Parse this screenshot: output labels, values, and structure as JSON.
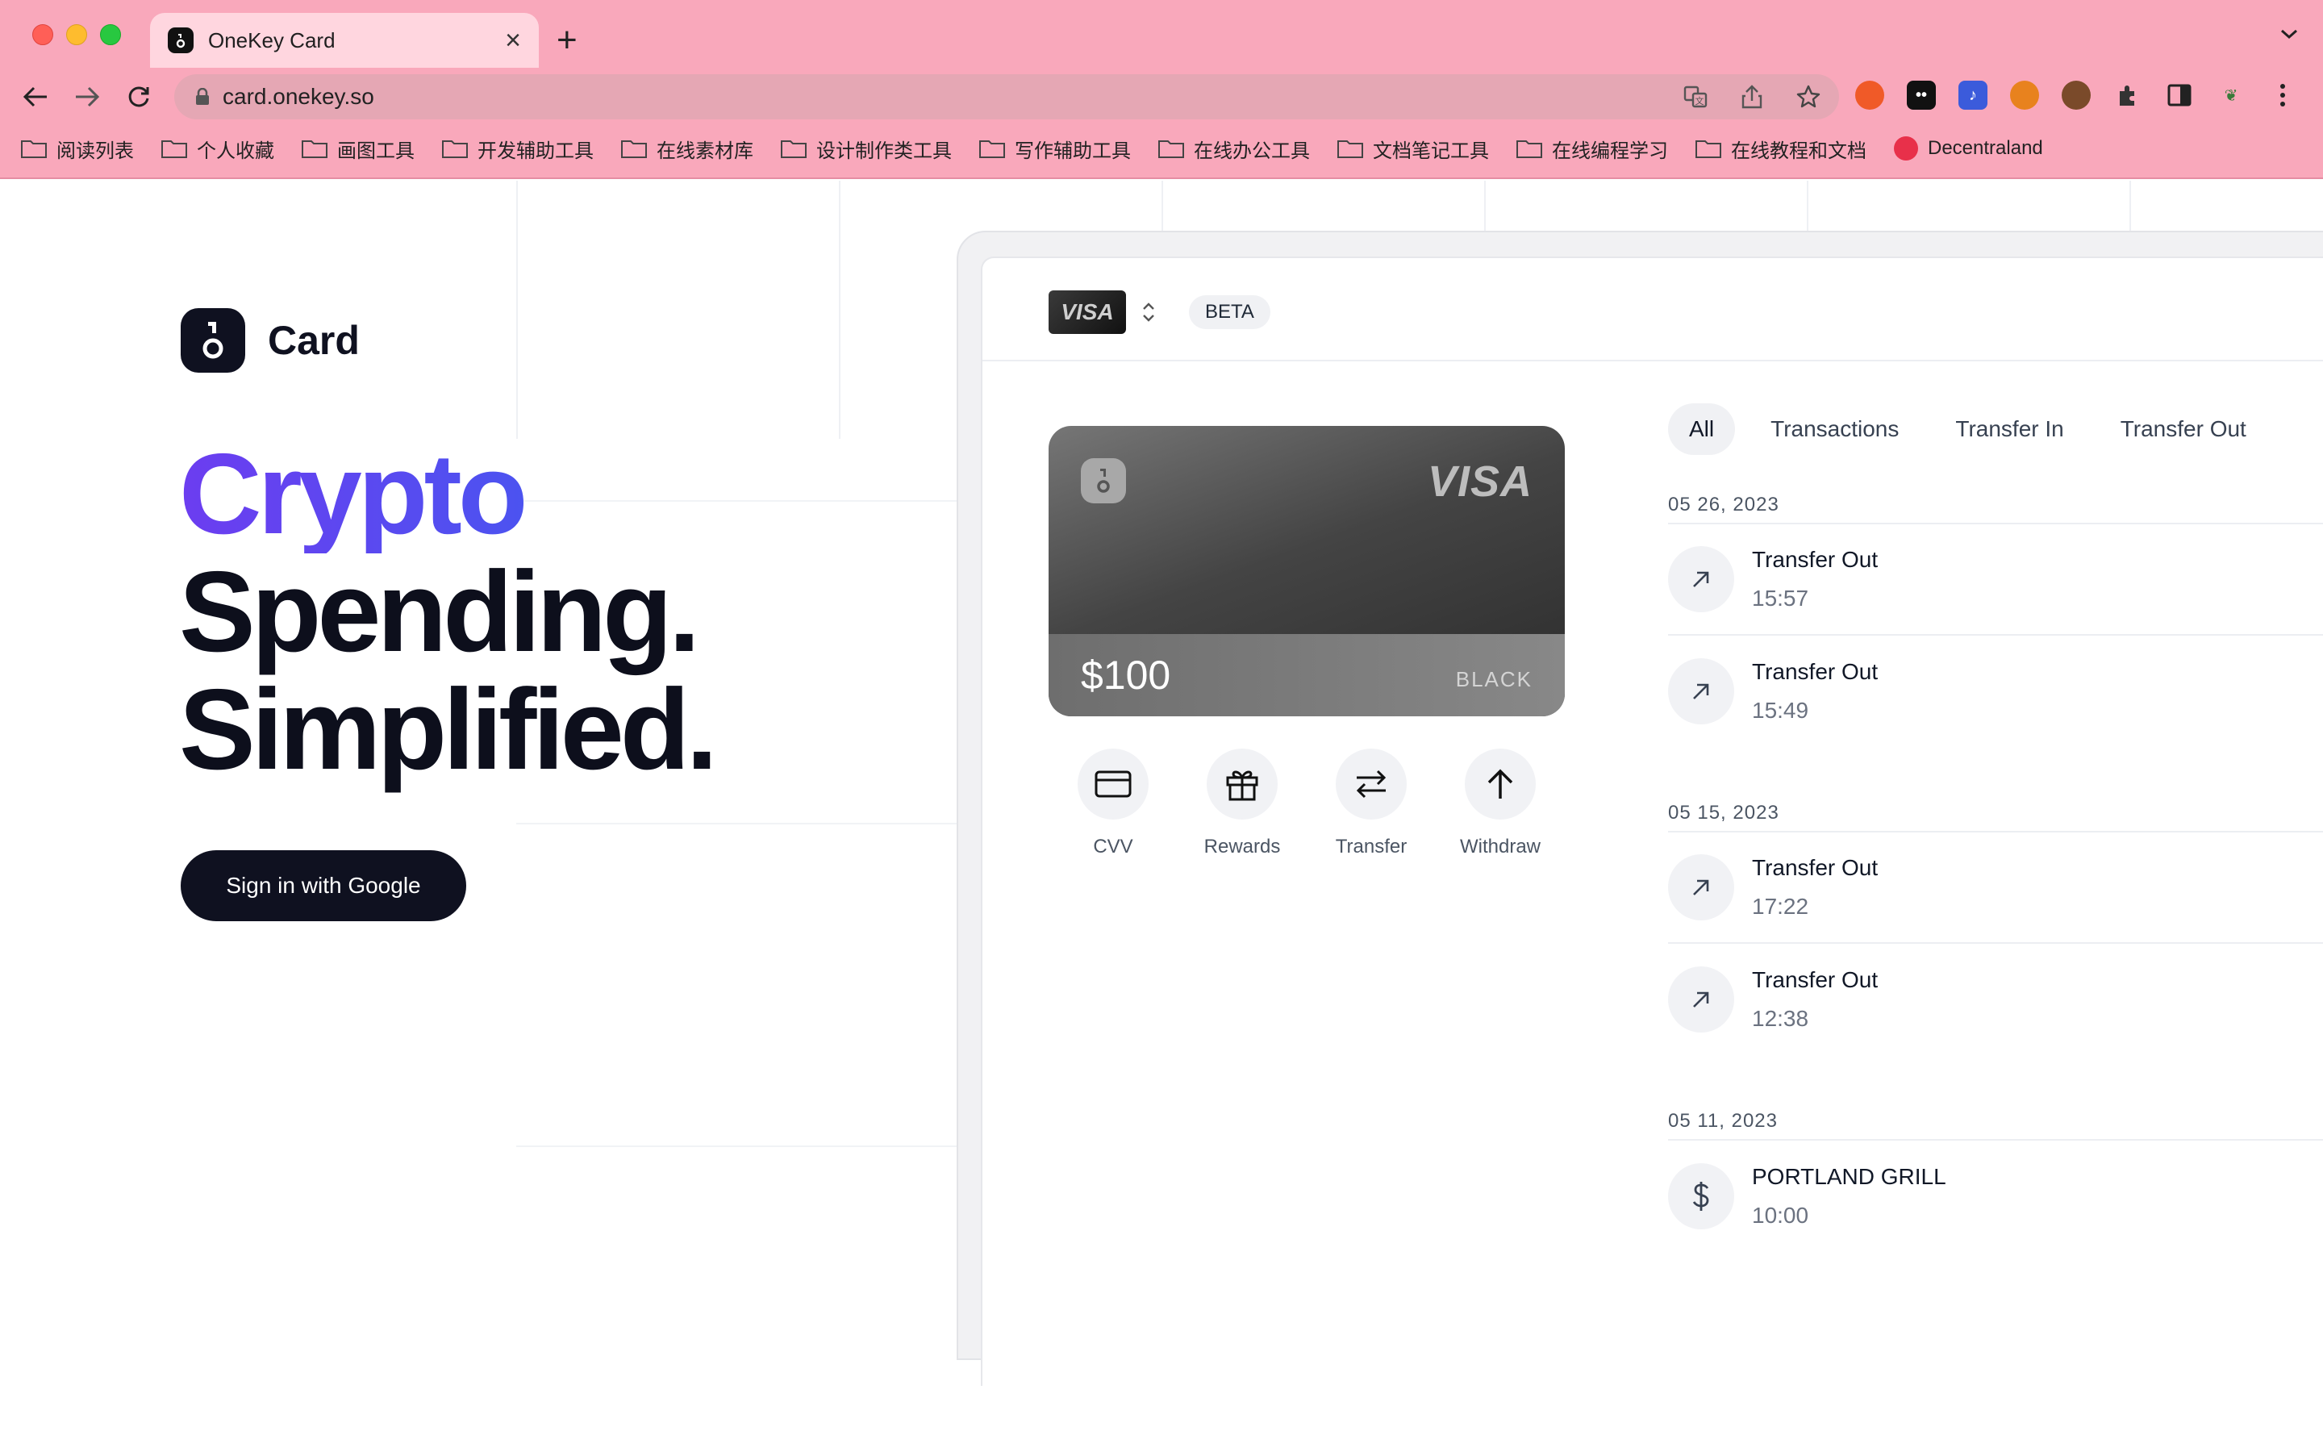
{
  "browser": {
    "tab_title": "OneKey Card",
    "url": "card.onekey.so",
    "bookmarks": [
      "阅读列表",
      "个人收藏",
      "画图工具",
      "开发辅助工具",
      "在线素材库",
      "设计制作类工具",
      "写作辅助工具",
      "在线办公工具",
      "文档笔记工具",
      "在线编程学习",
      "在线教程和文档"
    ],
    "bookmark_site": "Decentraland"
  },
  "hero": {
    "brand": "Card",
    "line1": "Crypto",
    "line2": "Spending.",
    "line3": "Simplified.",
    "signin_label": "Sign in with Google",
    "gradient_colors": [
      "#6c3df0",
      "#3a5ff0"
    ]
  },
  "app": {
    "card_brand": "VISA",
    "beta_label": "BETA",
    "card": {
      "network": "VISA",
      "balance": "$100",
      "tier": "BLACK"
    },
    "actions": [
      {
        "label": "CVV",
        "icon": "card-icon"
      },
      {
        "label": "Rewards",
        "icon": "gift-icon"
      },
      {
        "label": "Transfer",
        "icon": "transfer-icon"
      },
      {
        "label": "Withdraw",
        "icon": "arrow-up-icon"
      }
    ],
    "filters": [
      "All",
      "Transactions",
      "Transfer In",
      "Transfer Out"
    ],
    "groups": [
      {
        "date": "05 26, 2023",
        "items": [
          {
            "title": "Transfer Out",
            "time": "15:57",
            "icon": "arrow-out-icon"
          },
          {
            "title": "Transfer Out",
            "time": "15:49",
            "icon": "arrow-out-icon"
          }
        ]
      },
      {
        "date": "05 15, 2023",
        "items": [
          {
            "title": "Transfer Out",
            "time": "17:22",
            "icon": "arrow-out-icon"
          },
          {
            "title": "Transfer Out",
            "time": "12:38",
            "icon": "arrow-out-icon"
          }
        ]
      },
      {
        "date": "05 11, 2023",
        "items": [
          {
            "title": "PORTLAND GRILL",
            "time": "10:00",
            "icon": "dollar-icon"
          }
        ]
      }
    ]
  }
}
